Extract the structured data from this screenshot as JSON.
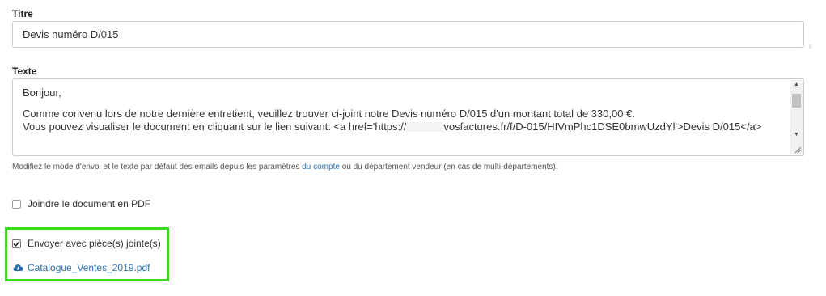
{
  "titre": {
    "label": "Titre",
    "value": "Devis numéro D/015"
  },
  "texte": {
    "label": "Texte",
    "line1": "Bonjour,",
    "line2": "Comme convenu lors de notre dernière entretient, veuillez trouver ci-joint notre Devis numéro D/015 d'un montant total de 330,00 €.",
    "line3_start": "Vous pouvez visualiser le document en cliquant sur le lien suivant: <a href='https://",
    "line3_end": "vosfactures.fr/f/D-015/HIVmPhc1DSE0bmwUzdYl'>Devis D/015</a>"
  },
  "help": {
    "before": "Modifiez le mode d'envoi et le texte par défaut des emails depuis les paramètres",
    "link": "du compte",
    "after": "ou du département vendeur (en cas de multi-départements)."
  },
  "pdf_option": {
    "label": "Joindre le document en PDF",
    "checked": false
  },
  "attachments_option": {
    "label": "Envoyer avec pièce(s) jointe(s)",
    "checked": true
  },
  "attachment": {
    "filename": "Catalogue_Ventes_2019.pdf",
    "icon": "cloud-download-icon"
  },
  "colors": {
    "link": "#2a6fb5",
    "highlight": "#3adb1f"
  }
}
